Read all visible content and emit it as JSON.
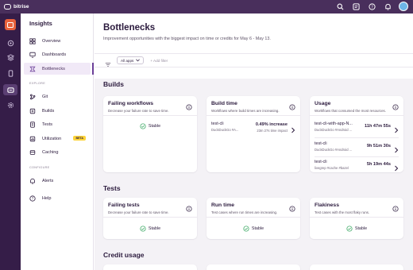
{
  "app": {
    "brand": "bitrise"
  },
  "subnav": {
    "title": "Insights",
    "items": [
      {
        "label": "Overview",
        "icon": "grid-icon"
      },
      {
        "label": "Dashboards",
        "icon": "monitor-icon"
      },
      {
        "label": "Bottlenecks",
        "icon": "bottleneck-icon",
        "active": true
      }
    ],
    "explore_label": "EXPLORE",
    "explore": [
      {
        "label": "Git",
        "icon": "git-icon"
      },
      {
        "label": "Builds",
        "icon": "builds-icon"
      },
      {
        "label": "Tests",
        "icon": "tests-icon"
      },
      {
        "label": "Utilization",
        "icon": "utilization-icon",
        "badge": "BETA"
      },
      {
        "label": "Caching",
        "icon": "caching-icon"
      }
    ],
    "configure_label": "CONFIGURE",
    "configure": [
      {
        "label": "Alerts",
        "icon": "alerts-icon"
      }
    ],
    "help": {
      "label": "Help",
      "icon": "help-icon"
    }
  },
  "header": {
    "title": "Bottlenecks",
    "subtitle": "Improvement opportunities with the biggest impact on time or credits for May 6 - May 13.",
    "apps_select": "All apps",
    "add_filter": "+ Add filter"
  },
  "builds": {
    "title": "Builds",
    "failing": {
      "title": "Failing workflows",
      "desc": "Decrease your failure rate to save time.",
      "status": "Stable"
    },
    "build_time": {
      "title": "Build time",
      "desc": "Workflows where build times are increasing.",
      "rows": [
        {
          "name": "test-cli",
          "meta": "DuckDuckGo #A...",
          "value": "0.49% increase",
          "sub": "23m 27s time impact"
        }
      ]
    },
    "usage": {
      "title": "Usage",
      "desc": "Workflows that consumed the most resources.",
      "rows": [
        {
          "name": "test-cli-with-app-N...",
          "meta": "DuckDuckGo #Android ...",
          "value": "11h 47m 55s"
        },
        {
          "name": "test-cli",
          "meta": "DuckDuckGo #Android ...",
          "value": "9h 51m 30s"
        },
        {
          "name": "test-cli",
          "meta": "livegrep #cache #bazel",
          "value": "5h 19m 44s"
        }
      ]
    }
  },
  "tests": {
    "title": "Tests",
    "failing": {
      "title": "Failing tests",
      "desc": "Decrease your failure rate to save time.",
      "status": "Stable"
    },
    "run_time": {
      "title": "Run time",
      "desc": "Test cases where run times are increasing.",
      "status": "Stable"
    },
    "flakiness": {
      "title": "Flakiness",
      "desc": "Test cases with the most flaky runs.",
      "status": "Stable"
    }
  },
  "credit": {
    "title": "Credit usage"
  },
  "colors": {
    "topbar": "#492f5c",
    "rail": "#351d48",
    "accent": "#6b3f98",
    "stable_green": "#2fa35a",
    "beta": "#fdd43a",
    "logo": "#e8613c"
  }
}
